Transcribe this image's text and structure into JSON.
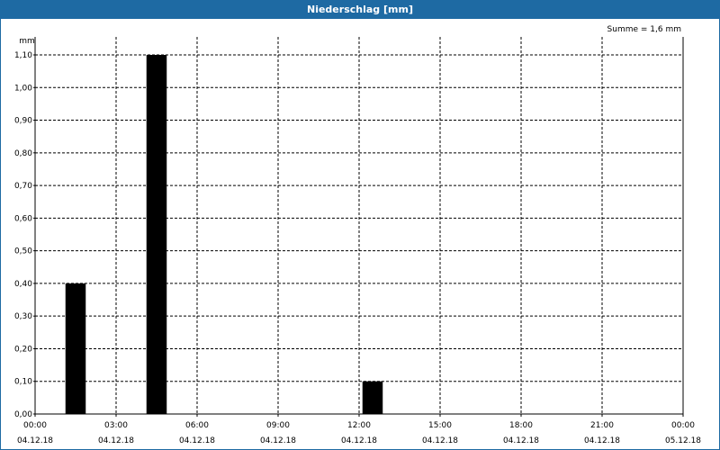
{
  "window": {
    "title": "Niederschlag [mm]"
  },
  "summary": "Summe = 1,6 mm",
  "colors": {
    "titlebar": "#1e6aa3",
    "bar": "#000000",
    "grid": "#000000"
  },
  "chart_data": {
    "type": "bar",
    "title": "Niederschlag [mm]",
    "ylabel": "mm",
    "ylim": [
      0,
      1.1
    ],
    "xlim": [
      "2018-12-04 00:00",
      "2018-12-05 00:00"
    ],
    "grid": true,
    "bar_width_hours": 0.75,
    "y_ticks": [
      "0,00",
      "0,10",
      "0,20",
      "0,30",
      "0,40",
      "0,50",
      "0,60",
      "0,70",
      "0,80",
      "0,90",
      "1,00",
      "1,10"
    ],
    "x_ticks": [
      {
        "time": "00:00",
        "date": "04.12.18"
      },
      {
        "time": "03:00",
        "date": "04.12.18"
      },
      {
        "time": "06:00",
        "date": "04.12.18"
      },
      {
        "time": "09:00",
        "date": "04.12.18"
      },
      {
        "time": "12:00",
        "date": "04.12.18"
      },
      {
        "time": "15:00",
        "date": "04.12.18"
      },
      {
        "time": "18:00",
        "date": "04.12.18"
      },
      {
        "time": "21:00",
        "date": "04.12.18"
      },
      {
        "time": "00:00",
        "date": "05.12.18"
      }
    ],
    "series": [
      {
        "values": [
          {
            "x": "2018-12-04 01:30",
            "y": 0.4
          },
          {
            "x": "2018-12-04 04:30",
            "y": 1.1
          },
          {
            "x": "2018-12-04 12:30",
            "y": 0.1
          }
        ]
      }
    ]
  }
}
